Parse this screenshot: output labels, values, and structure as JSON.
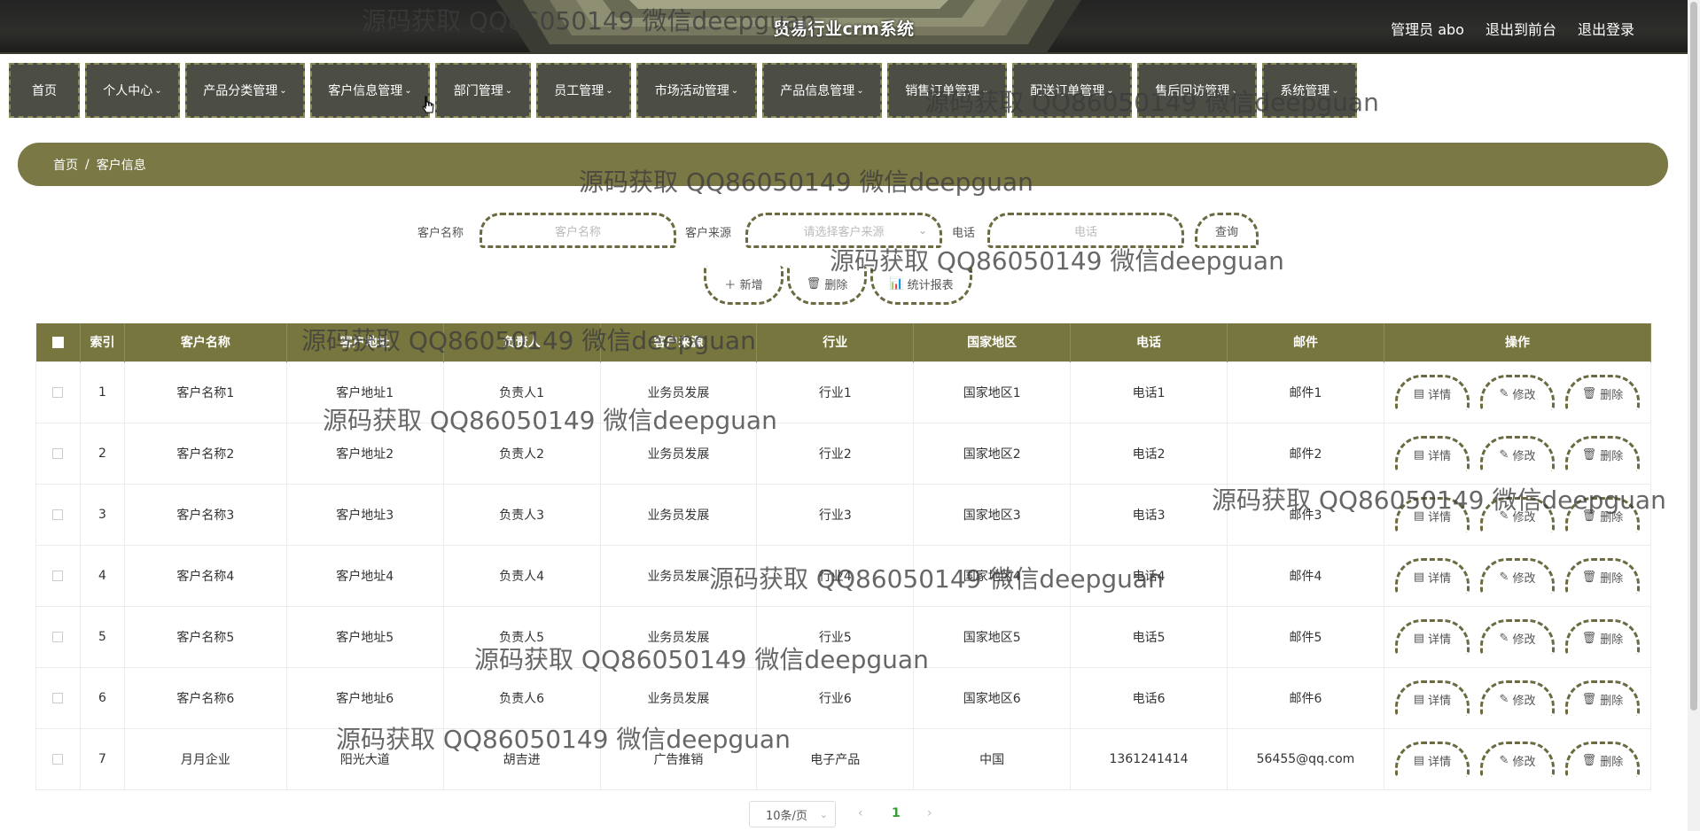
{
  "header": {
    "title": "贸易行业crm系统",
    "admin": "管理员 abo",
    "to_front": "退出到前台",
    "logout": "退出登录"
  },
  "nav": [
    {
      "label": "首页",
      "dropdown": false
    },
    {
      "label": "个人中心",
      "dropdown": true
    },
    {
      "label": "产品分类管理",
      "dropdown": true
    },
    {
      "label": "客户信息管理",
      "dropdown": true
    },
    {
      "label": "部门管理",
      "dropdown": true
    },
    {
      "label": "员工管理",
      "dropdown": true
    },
    {
      "label": "市场活动管理",
      "dropdown": true
    },
    {
      "label": "产品信息管理",
      "dropdown": true
    },
    {
      "label": "销售订单管理",
      "dropdown": true
    },
    {
      "label": "配送订单管理",
      "dropdown": true
    },
    {
      "label": "售后回访管理",
      "dropdown": true
    },
    {
      "label": "系统管理",
      "dropdown": true
    }
  ],
  "breadcrumb": {
    "home": "首页",
    "sep": "/",
    "current": "客户信息"
  },
  "search": {
    "name_label": "客户名称",
    "name_placeholder": "客户名称",
    "source_label": "客户来源",
    "source_placeholder": "请选择客户来源",
    "phone_label": "电话",
    "phone_placeholder": "电话",
    "query": "查询"
  },
  "actions": {
    "add": "新增",
    "delete": "删除",
    "report": "统计报表"
  },
  "table": {
    "headers": [
      "索引",
      "客户名称",
      "客户地址",
      "负责人",
      "客户来源",
      "行业",
      "国家地区",
      "电话",
      "邮件",
      "操作"
    ],
    "rows": [
      [
        "1",
        "客户名称1",
        "客户地址1",
        "负责人1",
        "业务员发展",
        "行业1",
        "国家地区1",
        "电话1",
        "邮件1"
      ],
      [
        "2",
        "客户名称2",
        "客户地址2",
        "负责人2",
        "业务员发展",
        "行业2",
        "国家地区2",
        "电话2",
        "邮件2"
      ],
      [
        "3",
        "客户名称3",
        "客户地址3",
        "负责人3",
        "业务员发展",
        "行业3",
        "国家地区3",
        "电话3",
        "邮件3"
      ],
      [
        "4",
        "客户名称4",
        "客户地址4",
        "负责人4",
        "业务员发展",
        "行业4",
        "国家地区4",
        "电话4",
        "邮件4"
      ],
      [
        "5",
        "客户名称5",
        "客户地址5",
        "负责人5",
        "业务员发展",
        "行业5",
        "国家地区5",
        "电话5",
        "邮件5"
      ],
      [
        "6",
        "客户名称6",
        "客户地址6",
        "负责人6",
        "业务员发展",
        "行业6",
        "国家地区6",
        "电话6",
        "邮件6"
      ],
      [
        "7",
        "月月企业",
        "阳光大道",
        "胡吉进",
        "广告推销",
        "电子产品",
        "中国",
        "1361241414",
        "56455@qq.com"
      ]
    ],
    "ops": {
      "detail": "详情",
      "edit": "修改",
      "delete": "删除"
    }
  },
  "pager": {
    "size": "10条/页",
    "prev": "‹",
    "page": "1",
    "next": "›"
  },
  "watermark": "源码获取 QQ86050149 微信deepguan",
  "colors": {
    "accent": "#77763f",
    "nav_bg": "#4c4d45",
    "dash": "#6b6a40"
  }
}
